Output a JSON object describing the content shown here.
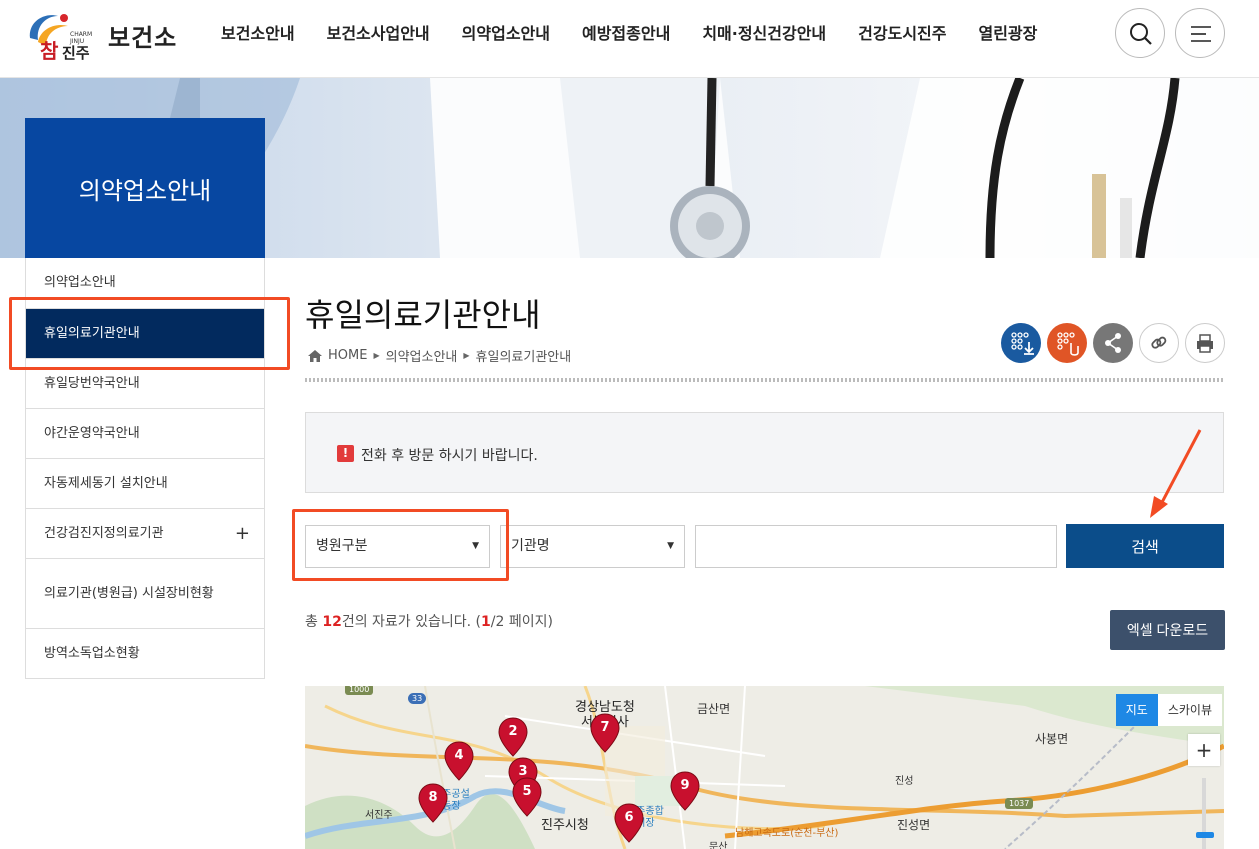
{
  "header": {
    "logo_text": "참진주 CHARM JINJU",
    "site_name": "보건소",
    "nav": [
      "보건소안내",
      "보건소사업안내",
      "의약업소안내",
      "예방접종안내",
      "치매·정신건강안내",
      "건강도시진주",
      "열린광장"
    ],
    "search_icon": "search-icon",
    "menu_icon": "hamburger-menu-icon"
  },
  "sidebar": {
    "title": "의약업소안내",
    "items": [
      {
        "label": "의약업소안내"
      },
      {
        "label": "휴일의료기관안내",
        "active": true
      },
      {
        "label": "휴일당번약국안내"
      },
      {
        "label": "야간운영약국안내"
      },
      {
        "label": "자동제세동기 설치안내"
      },
      {
        "label": "건강검진지정의료기관",
        "expand_icon": "+"
      },
      {
        "label": "의료기관(병원급) 시설장비현황"
      },
      {
        "label": "방역소독업소현황"
      }
    ]
  },
  "content": {
    "title": "휴일의료기관안내",
    "breadcrumb": {
      "home": "HOME",
      "level1": "의약업소안내",
      "level2": "휴일의료기관안내"
    },
    "util_icons": [
      "dots-download-icon",
      "dots-touch-icon",
      "share-icon",
      "link-icon",
      "print-icon"
    ],
    "notice": {
      "icon": "!",
      "text": "전화 후 방문 하시기 바랍니다."
    },
    "search": {
      "select1": "병원구분",
      "select2": "기관명",
      "keyword": "",
      "button": "검색"
    },
    "count": {
      "prefix": "총 ",
      "total": "12",
      "mid": "건의 자료가 있습니다. (",
      "page": "1",
      "suffix": "/2 페이지)"
    },
    "excel_button": "엑셀 다운로드"
  },
  "map": {
    "toggle_map": "지도",
    "toggle_sky": "스카이뷰",
    "zoom_in": "+",
    "labels": {
      "gov": "경상남도청",
      "gov2": "서부청사",
      "city_hall": "진주시청",
      "geumsan": "금산면",
      "sabong": "사봉면",
      "jinseong_myeon": "진성면",
      "jinseong": "진성",
      "seojinju": "서진주",
      "express": "남해고속도로(순천-부산)",
      "moonsan": "문산",
      "stadium": "진주종합경기장",
      "chuldong": "진주공설운동장"
    },
    "road_numbers": [
      "1000",
      "33",
      "1037"
    ],
    "markers": [
      "2",
      "7",
      "4",
      "3",
      "5",
      "9",
      "8",
      "6"
    ],
    "colors": {
      "marker": "#c8102e",
      "primary": "#0b4d8a",
      "sidebar": "#0747a1",
      "active": "#022a5e",
      "highlight": "#f24b24"
    }
  }
}
